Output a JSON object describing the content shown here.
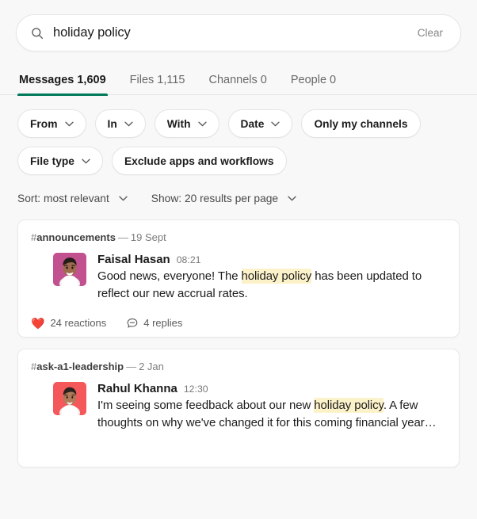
{
  "search": {
    "icon": "search-icon",
    "value": "holiday policy",
    "placeholder": "Search",
    "clear_label": "Clear"
  },
  "tabs": [
    {
      "label": "Messages 1,609",
      "active": true
    },
    {
      "label": "Files 1,115",
      "active": false
    },
    {
      "label": "Channels 0",
      "active": false
    },
    {
      "label": "People 0",
      "active": false
    }
  ],
  "filters": {
    "row1": [
      {
        "label": "From",
        "chevron": true
      },
      {
        "label": "In",
        "chevron": true
      },
      {
        "label": "With",
        "chevron": true
      },
      {
        "label": "Date",
        "chevron": true
      },
      {
        "label": "Only my channels",
        "chevron": false
      }
    ],
    "row2": [
      {
        "label": "File type",
        "chevron": true
      },
      {
        "label": "Exclude apps and workflows",
        "chevron": false
      }
    ]
  },
  "sort": {
    "sort_label": "Sort: most relevant",
    "show_label": "Show: 20 results per page"
  },
  "results": [
    {
      "channel": "announcements",
      "date": "19 Sept",
      "author": "Faisal Hasan",
      "time": "08:21",
      "avatar_bg": "#c2518f",
      "text_pre": "Good news, everyone! The ",
      "text_highlight": "holiday policy",
      "text_post": " has been updated to reflect our new accrual rates.",
      "reactions_label": "24 reactions",
      "reactions_emoji": "❤️",
      "replies_label": "4 replies"
    },
    {
      "channel": "ask-a1-leadership",
      "date": "2 Jan",
      "author": "Rahul Khanna",
      "time": "12:30",
      "avatar_bg": "#f4585b",
      "text_pre": "I'm seeing some feedback about our new ",
      "text_highlight": "holiday policy",
      "text_post": ". A few thoughts on why we've changed it for this coming financial year…"
    }
  ],
  "colors": {
    "accent_green": "#007a5a",
    "highlight_yellow": "#fcf2ca",
    "page_bg": "#f8f8f8",
    "card_bg": "#ffffff"
  }
}
